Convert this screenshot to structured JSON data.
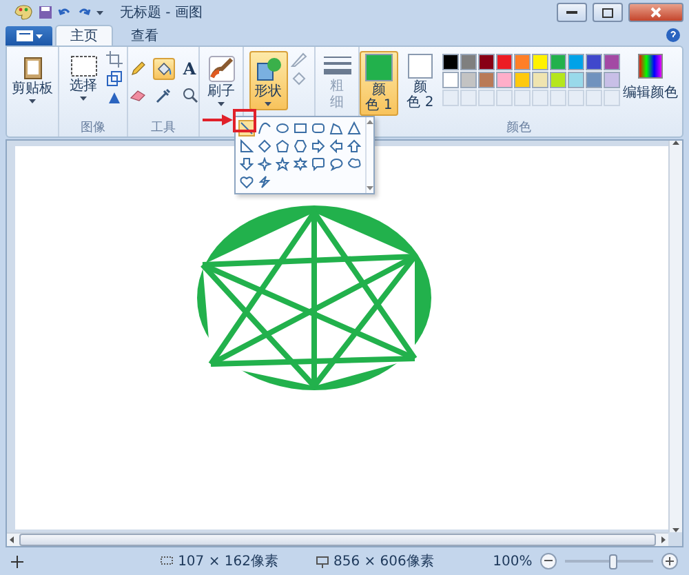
{
  "window": {
    "title": "无标题 - 画图"
  },
  "tabs": [
    {
      "label": "主页",
      "selected": true
    },
    {
      "label": "查看",
      "selected": false
    }
  ],
  "ribbon": {
    "clipboard": {
      "label": "剪贴板"
    },
    "image": {
      "select_label": "选择",
      "group_label": "图像"
    },
    "tools": {
      "group_label": "工具",
      "items": [
        {
          "kind": "pencil",
          "selected": false
        },
        {
          "kind": "fill",
          "selected": true
        },
        {
          "kind": "text",
          "glyph": "A",
          "selected": false
        },
        {
          "kind": "eraser",
          "selected": false
        },
        {
          "kind": "picker",
          "selected": false
        },
        {
          "kind": "magnifier",
          "selected": false
        }
      ]
    },
    "brushes": {
      "label": "刷子"
    },
    "shapes": {
      "label": "形状",
      "open": true
    },
    "size": {
      "label": "粗细",
      "disabled": true
    },
    "colors": {
      "group_label": "颜色",
      "edit_label": "编辑颜色",
      "color1": {
        "label": "颜色 1",
        "color": "#22b14c",
        "selected": true
      },
      "color2": {
        "label": "颜色 2",
        "color": "#ffffff",
        "selected": false
      },
      "palette": [
        {
          "kind": "color",
          "color": "#000000"
        },
        {
          "kind": "color",
          "color": "#7f7f7f"
        },
        {
          "kind": "color",
          "color": "#880015"
        },
        {
          "kind": "color",
          "color": "#ed1c24"
        },
        {
          "kind": "color",
          "color": "#ff7f27"
        },
        {
          "kind": "color",
          "color": "#fff200"
        },
        {
          "kind": "color",
          "color": "#22b14c"
        },
        {
          "kind": "color",
          "color": "#00a2e8"
        },
        {
          "kind": "color",
          "color": "#3f48cc"
        },
        {
          "kind": "color",
          "color": "#a349a4"
        },
        {
          "kind": "color",
          "color": "#ffffff"
        },
        {
          "kind": "color",
          "color": "#c3c3c3"
        },
        {
          "kind": "color",
          "color": "#b97a57"
        },
        {
          "kind": "color",
          "color": "#ffaec9"
        },
        {
          "kind": "color",
          "color": "#ffc90e"
        },
        {
          "kind": "color",
          "color": "#efe4b0"
        },
        {
          "kind": "color",
          "color": "#b5e61d"
        },
        {
          "kind": "color",
          "color": "#99d9ea"
        },
        {
          "kind": "color",
          "color": "#7092be"
        },
        {
          "kind": "color",
          "color": "#c8bfe7"
        },
        {
          "kind": "empty"
        },
        {
          "kind": "empty"
        },
        {
          "kind": "empty"
        },
        {
          "kind": "empty"
        },
        {
          "kind": "empty"
        },
        {
          "kind": "empty"
        },
        {
          "kind": "empty"
        },
        {
          "kind": "empty"
        },
        {
          "kind": "empty"
        },
        {
          "kind": "empty"
        }
      ]
    }
  },
  "shape_menu": {
    "items": [
      {
        "kind": "line",
        "selected": true
      },
      {
        "kind": "curve",
        "selected": false
      },
      {
        "kind": "oval",
        "selected": false
      },
      {
        "kind": "rectangle",
        "selected": false
      },
      {
        "kind": "rounded-rectangle",
        "selected": false
      },
      {
        "kind": "polygon",
        "selected": false
      },
      {
        "kind": "triangle",
        "selected": false
      },
      {
        "kind": "right-triangle",
        "selected": false
      },
      {
        "kind": "diamond",
        "selected": false
      },
      {
        "kind": "pentagon",
        "selected": false
      },
      {
        "kind": "hexagon",
        "selected": false
      },
      {
        "kind": "right-arrow",
        "selected": false
      },
      {
        "kind": "left-arrow",
        "selected": false
      },
      {
        "kind": "up-arrow",
        "selected": false
      },
      {
        "kind": "down-arrow",
        "selected": false
      },
      {
        "kind": "star4",
        "selected": false
      },
      {
        "kind": "star5",
        "selected": false
      },
      {
        "kind": "star6",
        "selected": false
      },
      {
        "kind": "rounded-callout",
        "selected": false
      },
      {
        "kind": "oval-callout",
        "selected": false
      },
      {
        "kind": "cloud-callout",
        "selected": false
      },
      {
        "kind": "heart",
        "selected": false
      },
      {
        "kind": "lightning",
        "selected": false
      }
    ]
  },
  "status_bar": {
    "selection_size": "107 × 162像素",
    "canvas_size": "856 × 606像素",
    "zoom": "100%",
    "zoom_slider": {
      "level": 0.55
    }
  }
}
